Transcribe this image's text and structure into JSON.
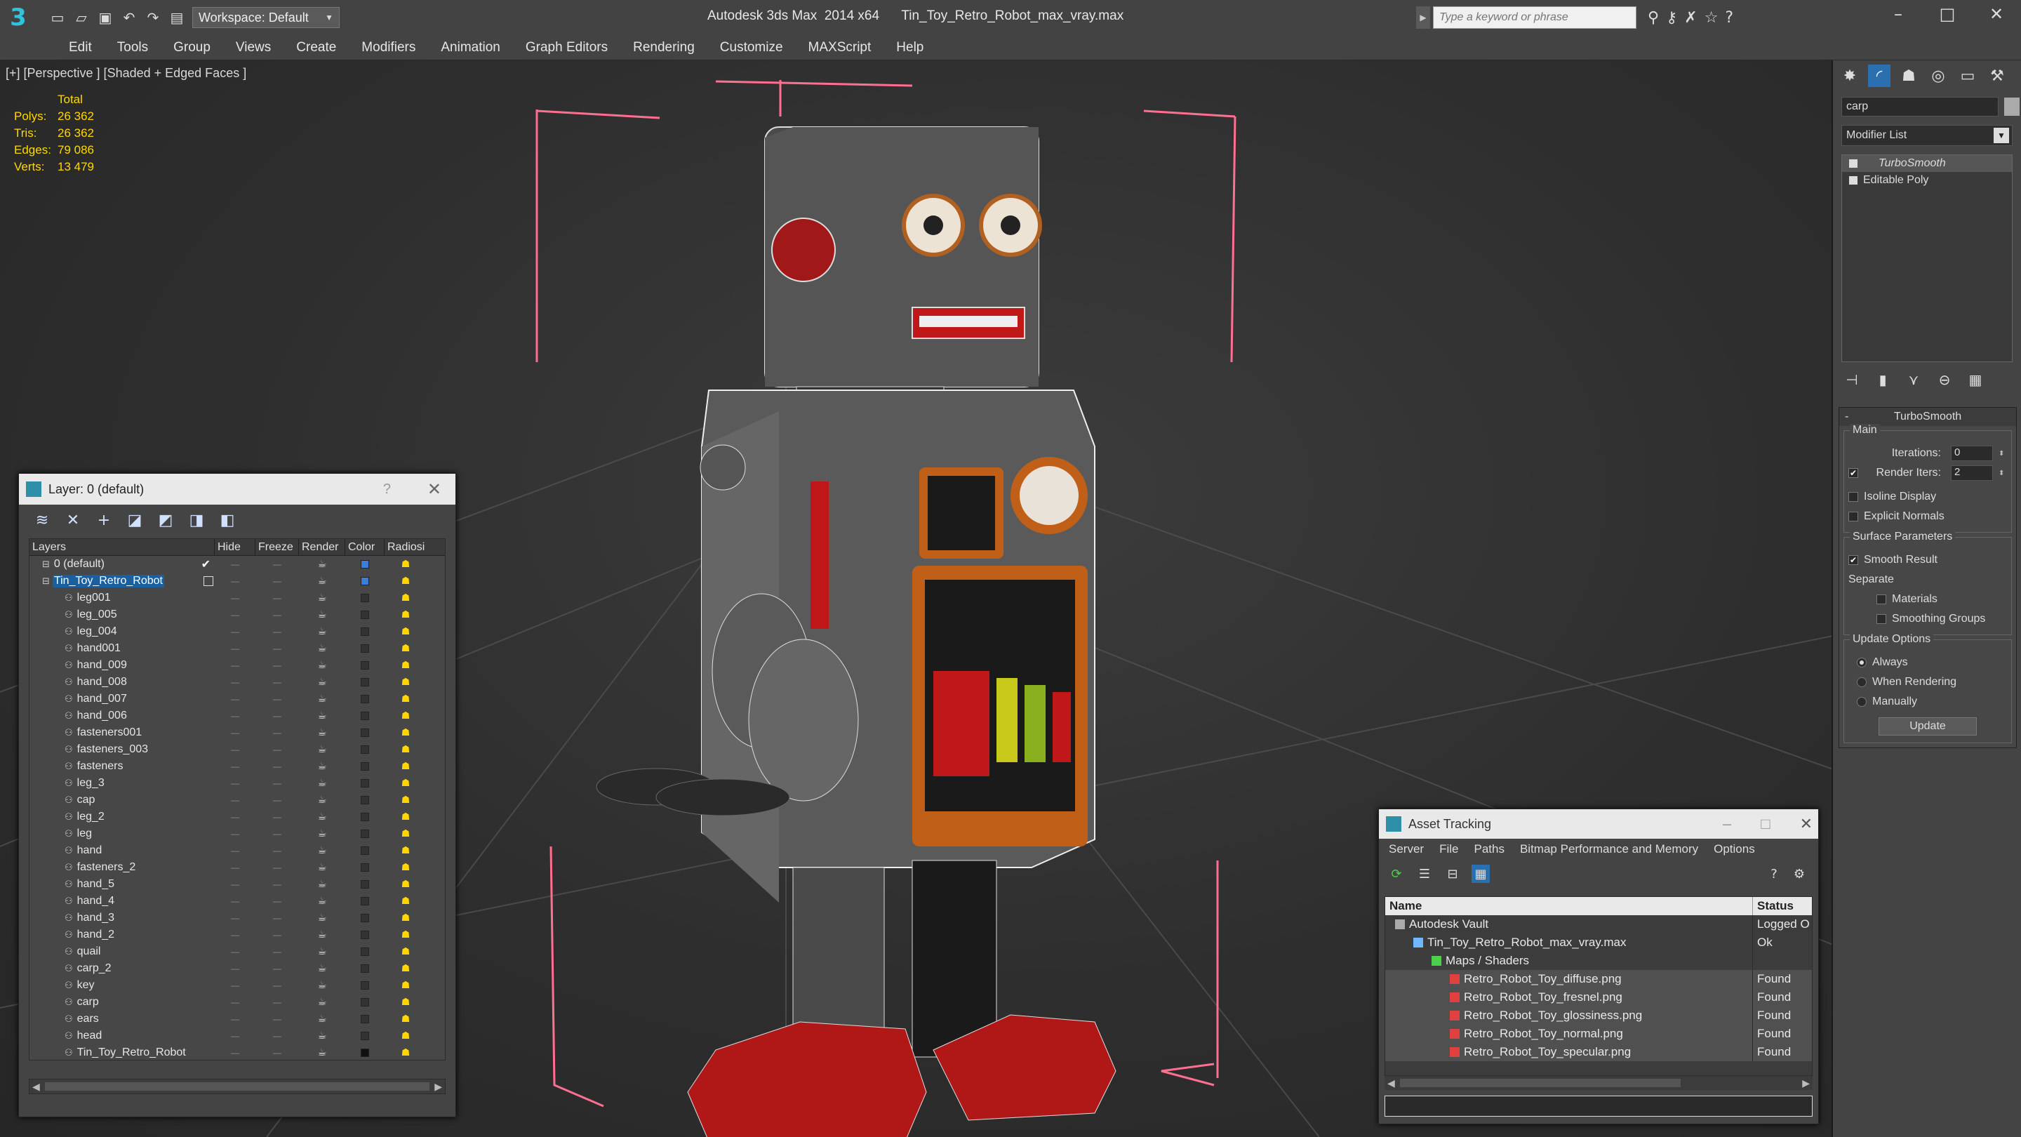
{
  "titlebar": {
    "app_title": "Autodesk 3ds Max  2014 x64",
    "file_title": "Tin_Toy_Retro_Robot_max_vray.max",
    "workspace": "Workspace: Default",
    "search_placeholder": "Type a keyword or phrase",
    "logo_glyph": "3",
    "quick_access_icons": [
      "new-icon",
      "open-icon",
      "save-icon",
      "undo-icon",
      "redo-icon",
      "project-icon"
    ],
    "window_buttons": {
      "minimize": "–",
      "maximize": "□",
      "close": "✕"
    }
  },
  "menu": [
    "Edit",
    "Tools",
    "Group",
    "Views",
    "Create",
    "Modifiers",
    "Animation",
    "Graph Editors",
    "Rendering",
    "Customize",
    "MAXScript",
    "Help"
  ],
  "viewport": {
    "label": "[+] [Perspective ] [Shaded + Edged Faces ]",
    "stats_header": "Total",
    "stats": [
      {
        "k": "Polys:",
        "v": "26 362"
      },
      {
        "k": "Tris:",
        "v": "26 362"
      },
      {
        "k": "Edges:",
        "v": "79 086"
      },
      {
        "k": "Verts:",
        "v": "13 479"
      }
    ]
  },
  "layer_dialog": {
    "title": "Layer: 0 (default)",
    "help": "?",
    "close": "✕",
    "columns": [
      "Layers",
      "Hide",
      "Freeze",
      "Render",
      "Color",
      "Radiosi"
    ],
    "rows": [
      {
        "name": "0 (default)",
        "level": 0,
        "color": "#3a7fd5",
        "active": true
      },
      {
        "name": "Tin_Toy_Retro_Robot",
        "level": 0,
        "color": "#3a7fd5",
        "selected": true
      },
      {
        "name": "leg001",
        "level": 1
      },
      {
        "name": "leg_005",
        "level": 1
      },
      {
        "name": "leg_004",
        "level": 1
      },
      {
        "name": "hand001",
        "level": 1
      },
      {
        "name": "hand_009",
        "level": 1
      },
      {
        "name": "hand_008",
        "level": 1
      },
      {
        "name": "hand_007",
        "level": 1
      },
      {
        "name": "hand_006",
        "level": 1
      },
      {
        "name": "fasteners001",
        "level": 1
      },
      {
        "name": "fasteners_003",
        "level": 1
      },
      {
        "name": "fasteners",
        "level": 1
      },
      {
        "name": "leg_3",
        "level": 1
      },
      {
        "name": "cap",
        "level": 1
      },
      {
        "name": "leg_2",
        "level": 1
      },
      {
        "name": "leg",
        "level": 1
      },
      {
        "name": "hand",
        "level": 1
      },
      {
        "name": "fasteners_2",
        "level": 1
      },
      {
        "name": "hand_5",
        "level": 1
      },
      {
        "name": "hand_4",
        "level": 1
      },
      {
        "name": "hand_3",
        "level": 1
      },
      {
        "name": "hand_2",
        "level": 1
      },
      {
        "name": "quail",
        "level": 1
      },
      {
        "name": "carp_2",
        "level": 1
      },
      {
        "name": "key",
        "level": 1
      },
      {
        "name": "carp",
        "level": 1
      },
      {
        "name": "ears",
        "level": 1
      },
      {
        "name": "head",
        "level": 1
      },
      {
        "name": "Tin_Toy_Retro_Robot",
        "level": 1,
        "color": "#111111"
      }
    ]
  },
  "command_panel": {
    "object_name": "carp",
    "modifier_list": "Modifier List",
    "stack": [
      "TurboSmooth",
      "Editable Poly"
    ],
    "rollout_title": "TurboSmooth",
    "main_group": "Main",
    "iterations_label": "Iterations:",
    "iterations": "0",
    "render_iters_label": "Render Iters:",
    "render_iters": "2",
    "isoline": "Isoline Display",
    "explicit_normals": "Explicit Normals",
    "surface_group": "Surface Parameters",
    "smooth_result": "Smooth Result",
    "separate": "Separate",
    "materials": "Materials",
    "smoothing_groups": "Smoothing Groups",
    "update_group": "Update Options",
    "always": "Always",
    "when_rendering": "When Rendering",
    "manually": "Manually",
    "update_button": "Update"
  },
  "asset_tracking": {
    "title": "Asset Tracking",
    "menu": [
      "Server",
      "File",
      "Paths",
      "Bitmap Performance and Memory",
      "Options"
    ],
    "columns": [
      "Name",
      "Status"
    ],
    "rows": [
      {
        "name": "Autodesk Vault",
        "status": "Logged O",
        "indent": 0,
        "icon": "vault"
      },
      {
        "name": "Tin_Toy_Retro_Robot_max_vray.max",
        "status": "Ok",
        "indent": 1,
        "icon": "max"
      },
      {
        "name": "Maps / Shaders",
        "status": "",
        "indent": 2,
        "icon": "folder"
      },
      {
        "name": "Retro_Robot_Toy_diffuse.png",
        "status": "Found",
        "indent": 3,
        "icon": "png"
      },
      {
        "name": "Retro_Robot_Toy_fresnel.png",
        "status": "Found",
        "indent": 3,
        "icon": "png"
      },
      {
        "name": "Retro_Robot_Toy_glossiness.png",
        "status": "Found",
        "indent": 3,
        "icon": "png"
      },
      {
        "name": "Retro_Robot_Toy_normal.png",
        "status": "Found",
        "indent": 3,
        "icon": "png"
      },
      {
        "name": "Retro_Robot_Toy_specular.png",
        "status": "Found",
        "indent": 3,
        "icon": "png"
      }
    ]
  },
  "colors": {
    "accent": "#2a6fb0",
    "stats": "#ffd700",
    "robot_red": "#b01818",
    "selection": "#1a5fa0"
  }
}
